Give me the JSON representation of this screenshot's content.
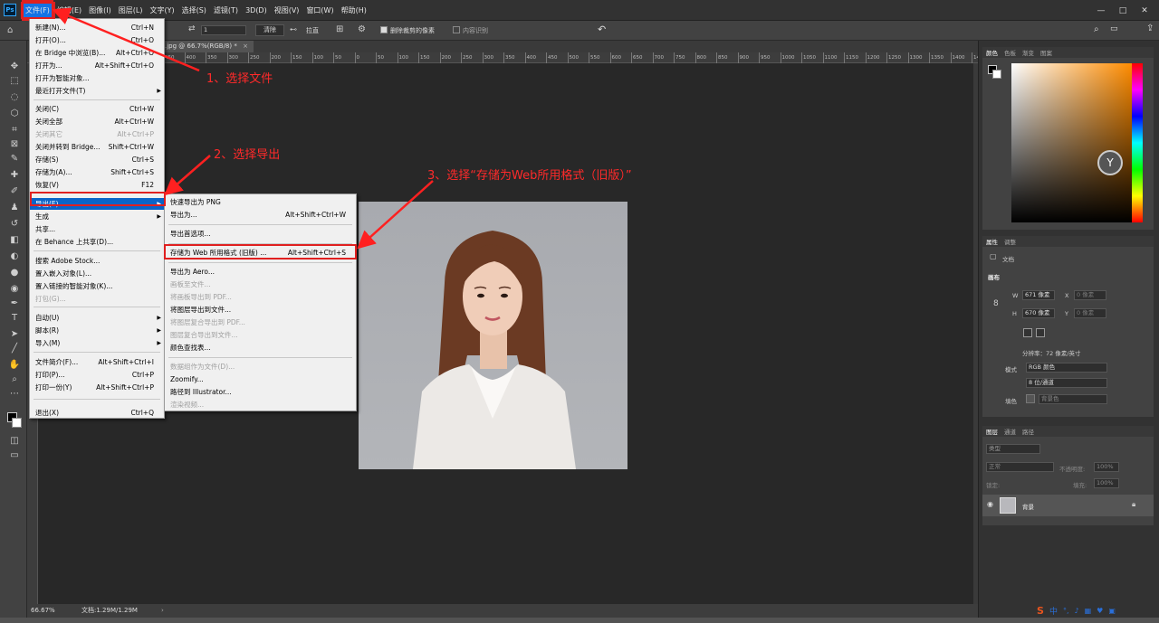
{
  "menubar": {
    "logo": "Ps",
    "items": [
      "文件(F)",
      "编辑(E)",
      "图像(I)",
      "图层(L)",
      "文字(Y)",
      "选择(S)",
      "滤镜(T)",
      "3D(D)",
      "视图(V)",
      "窗口(W)",
      "帮助(H)"
    ]
  },
  "optionsbar": {
    "angle": "1",
    "clear": "清除",
    "straighten": "拉直",
    "delete_cropped": "删除裁剪的像素",
    "content_aware": "内容识别"
  },
  "document": {
    "tab": ".jpg @ 66.7%(RGB/8) *",
    "zoom": "66.67%",
    "doc_size": "文档:1.29M/1.29M"
  },
  "ruler_ticks": [
    "450",
    "400",
    "350",
    "300",
    "250",
    "200",
    "150",
    "100",
    "50",
    "0",
    "50",
    "100",
    "150",
    "200",
    "250",
    "300",
    "350",
    "400",
    "450",
    "500",
    "550",
    "600",
    "650",
    "700",
    "750",
    "800",
    "850",
    "900",
    "950",
    "1000",
    "1050",
    "1100",
    "1150",
    "1200",
    "1250",
    "1300",
    "1350",
    "1400",
    "14"
  ],
  "file_menu": [
    {
      "label": "新建(N)...",
      "shortcut": "Ctrl+N"
    },
    {
      "label": "打开(O)...",
      "shortcut": "Ctrl+O"
    },
    {
      "label": "在 Bridge 中浏览(B)...",
      "shortcut": "Alt+Ctrl+O"
    },
    {
      "label": "打开为...",
      "shortcut": "Alt+Shift+Ctrl+O"
    },
    {
      "label": "打开为智能对象...",
      "shortcut": ""
    },
    {
      "label": "最近打开文件(T)",
      "shortcut": ""
    },
    {
      "label": "关闭(C)",
      "shortcut": "Ctrl+W"
    },
    {
      "label": "关闭全部",
      "shortcut": "Alt+Ctrl+W"
    },
    {
      "label": "关闭其它",
      "shortcut": "Alt+Ctrl+P"
    },
    {
      "label": "关闭并转到 Bridge...",
      "shortcut": "Shift+Ctrl+W"
    },
    {
      "label": "存储(S)",
      "shortcut": "Ctrl+S"
    },
    {
      "label": "存储为(A)...",
      "shortcut": "Shift+Ctrl+S"
    },
    {
      "label": "恢复(V)",
      "shortcut": "F12"
    },
    {
      "label": "导出(E)",
      "shortcut": ""
    },
    {
      "label": "生成",
      "shortcut": ""
    },
    {
      "label": "共享...",
      "shortcut": ""
    },
    {
      "label": "在 Behance 上共享(D)...",
      "shortcut": ""
    },
    {
      "label": "搜索 Adobe Stock...",
      "shortcut": ""
    },
    {
      "label": "置入嵌入对象(L)...",
      "shortcut": ""
    },
    {
      "label": "置入链接的智能对象(K)...",
      "shortcut": ""
    },
    {
      "label": "打包(G)...",
      "shortcut": ""
    },
    {
      "label": "自动(U)",
      "shortcut": ""
    },
    {
      "label": "脚本(R)",
      "shortcut": ""
    },
    {
      "label": "导入(M)",
      "shortcut": ""
    },
    {
      "label": "文件简介(F)...",
      "shortcut": "Alt+Shift+Ctrl+I"
    },
    {
      "label": "打印(P)...",
      "shortcut": "Ctrl+P"
    },
    {
      "label": "打印一份(Y)",
      "shortcut": "Alt+Shift+Ctrl+P"
    },
    {
      "label": "退出(X)",
      "shortcut": "Ctrl+Q"
    }
  ],
  "export_menu": [
    {
      "label": "快速导出为 PNG",
      "shortcut": ""
    },
    {
      "label": "导出为...",
      "shortcut": "Alt+Shift+Ctrl+W"
    },
    {
      "label": "导出首选项...",
      "shortcut": ""
    },
    {
      "label": "存储为 Web 所用格式 (旧版) ...",
      "shortcut": "Alt+Shift+Ctrl+S"
    },
    {
      "label": "导出为 Aero...",
      "shortcut": ""
    },
    {
      "label": "画板至文件...",
      "shortcut": ""
    },
    {
      "label": "将画板导出到 PDF...",
      "shortcut": ""
    },
    {
      "label": "将图层导出到文件...",
      "shortcut": ""
    },
    {
      "label": "将图层复合导出到 PDF...",
      "shortcut": ""
    },
    {
      "label": "图层复合导出到文件...",
      "shortcut": ""
    },
    {
      "label": "颜色查找表...",
      "shortcut": ""
    },
    {
      "label": "数据组作为文件(D)...",
      "shortcut": ""
    },
    {
      "label": "Zoomify...",
      "shortcut": ""
    },
    {
      "label": "路径到 Illustrator...",
      "shortcut": ""
    },
    {
      "label": "渲染视频...",
      "shortcut": ""
    }
  ],
  "annotations": {
    "step1": "1、选择文件",
    "step2": "2、选择导出",
    "step3": "3、选择“存储为Web所用格式（旧版）”"
  },
  "panels": {
    "color_tabs": [
      "颜色",
      "色板",
      "渐变",
      "图案"
    ],
    "props_tabs": [
      "属性",
      "调整"
    ],
    "doc_label": "文档",
    "canvas_label": "画布",
    "w_label": "W",
    "w_value": "671 像素",
    "h_label": "H",
    "h_value": "670 像素",
    "x_label": "X",
    "x_placeholder": "0 像素",
    "y_label": "Y",
    "y_placeholder": "0 像素",
    "resolution": "分辨率：72 像素/英寸",
    "mode_label": "模式",
    "mode_value": "RGB 颜色",
    "depth_value": "8 位/通道",
    "fill_label": "填色",
    "fill_value": "背景色",
    "layers_tabs": [
      "图层",
      "通道",
      "路径"
    ],
    "layer_kind": "类型",
    "blend_mode": "正常",
    "opacity_label": "不透明度:",
    "opacity_value": "100%",
    "lock_label": "锁定:",
    "fill_pct_label": "填充:",
    "fill_pct_value": "100%",
    "layer_name": "背景"
  },
  "ime": {
    "lang": "中"
  }
}
